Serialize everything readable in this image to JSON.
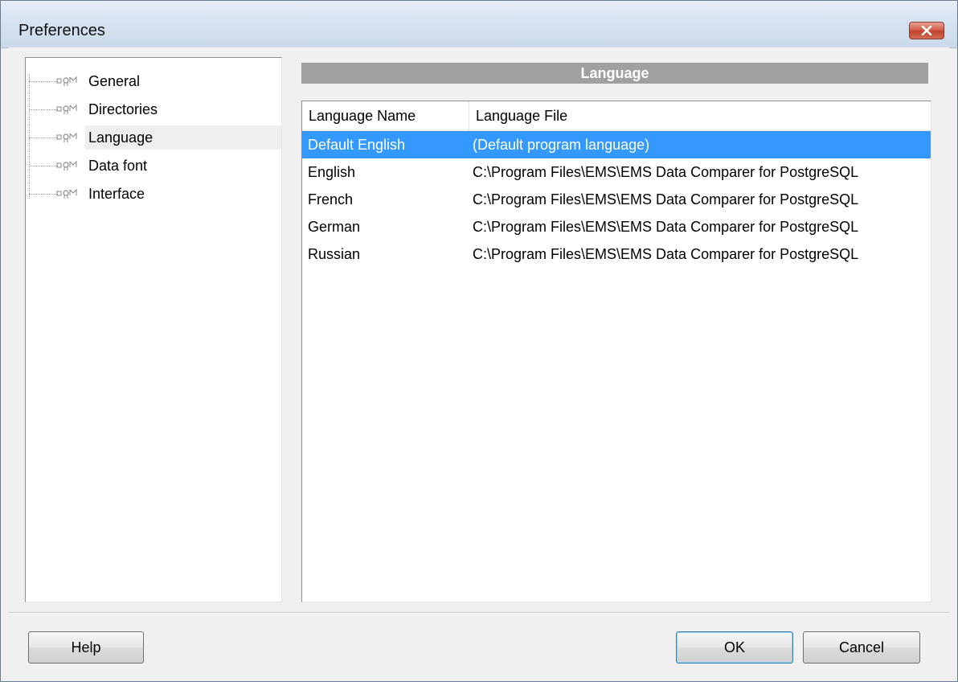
{
  "window": {
    "title": "Preferences"
  },
  "tree": {
    "items": [
      {
        "label": "General",
        "selected": false
      },
      {
        "label": "Directories",
        "selected": false
      },
      {
        "label": "Language",
        "selected": true
      },
      {
        "label": "Data font",
        "selected": false
      },
      {
        "label": "Interface",
        "selected": false
      }
    ]
  },
  "section": {
    "title": "Language"
  },
  "languages": {
    "columns": [
      "Language Name",
      "Language File"
    ],
    "rows": [
      {
        "name": "Default English",
        "file": "(Default program language)",
        "selected": true
      },
      {
        "name": "English",
        "file": "C:\\Program Files\\EMS\\EMS Data Comparer for PostgreSQL",
        "selected": false
      },
      {
        "name": "French",
        "file": "C:\\Program Files\\EMS\\EMS Data Comparer for PostgreSQL",
        "selected": false
      },
      {
        "name": "German",
        "file": "C:\\Program Files\\EMS\\EMS Data Comparer for PostgreSQL",
        "selected": false
      },
      {
        "name": "Russian",
        "file": "C:\\Program Files\\EMS\\EMS Data Comparer for PostgreSQL",
        "selected": false
      }
    ]
  },
  "buttons": {
    "help": "Help",
    "ok": "OK",
    "cancel": "Cancel"
  },
  "colors": {
    "selection": "#3399ff",
    "section_header": "#a0a0a0"
  },
  "icons": {
    "tree_item": "options-node-icon",
    "close": "close-icon"
  }
}
